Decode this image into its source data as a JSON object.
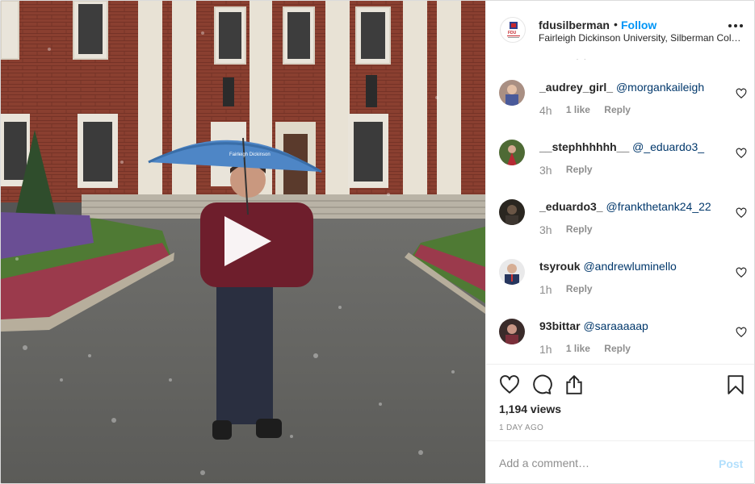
{
  "header": {
    "username": "fdusilberman",
    "separator": "•",
    "follow_label": "Follow",
    "location": "Fairleigh Dickinson University, Silberman College of Business",
    "avatar_text": "FDU",
    "more_icon": "more-horizontal-icon"
  },
  "media": {
    "type": "video",
    "play_icon": "play-icon",
    "umbrella_text": "Fairleigh Dickinson"
  },
  "comments_clipped_text": "· ·",
  "comments": [
    {
      "username": "_audrey_girl_",
      "mention": "@morgankaileigh",
      "time": "4h",
      "likes": "1 like",
      "reply": "Reply"
    },
    {
      "username": "__stephhhhhh__",
      "mention": "@_eduardo3_",
      "time": "3h",
      "likes": "",
      "reply": "Reply"
    },
    {
      "username": "_eduardo3_",
      "mention": "@frankthetank24_22",
      "time": "3h",
      "likes": "",
      "reply": "Reply"
    },
    {
      "username": "tsyrouk",
      "mention": "@andrewluminello",
      "time": "1h",
      "likes": "",
      "reply": "Reply"
    },
    {
      "username": "93bittar",
      "mention": "@saraaaaap",
      "time": "1h",
      "likes": "1 like",
      "reply": "Reply"
    }
  ],
  "actions": {
    "like_icon": "heart-icon",
    "comment_icon": "comment-icon",
    "share_icon": "share-icon",
    "save_icon": "bookmark-icon"
  },
  "views": "1,194 views",
  "posted": "1 DAY AGO",
  "add_comment": {
    "placeholder": "Add a comment…",
    "post_label": "Post"
  },
  "colors": {
    "accent": "#0095f6",
    "mention": "#00376b",
    "secondary_text": "#8e8e8e",
    "post_disabled": "#b2dffc"
  }
}
